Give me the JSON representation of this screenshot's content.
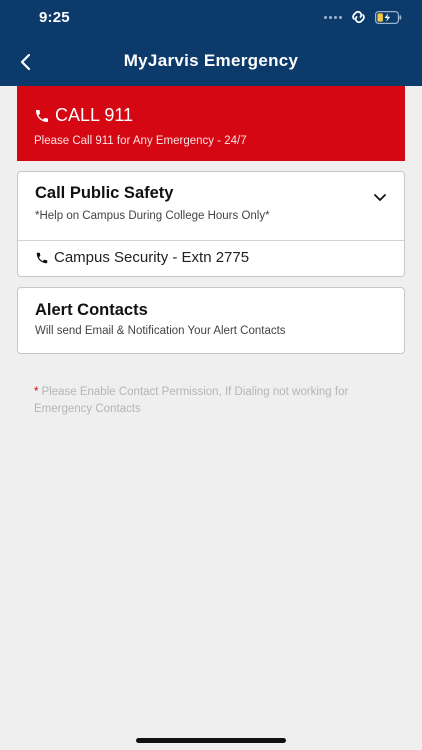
{
  "status_bar": {
    "time": "9:25"
  },
  "header": {
    "title": "MyJarvis Emergency"
  },
  "call_911": {
    "title": "CALL 911",
    "subtitle": "Please Call 911 for Any Emergency - 24/7"
  },
  "public_safety": {
    "title": "Call Public Safety",
    "subtitle": "*Help on Campus During College Hours Only*",
    "contact": "Campus Security - Extn 2775"
  },
  "alert_contacts": {
    "title": "Alert Contacts",
    "subtitle": "Will send Email & Notification Your Alert Contacts"
  },
  "note": {
    "asterisk": "*",
    "text": "Please Enable Contact Permission, If Dialing not working for Emergency Contacts"
  },
  "colors": {
    "header": "#0b3a6b",
    "emergency_red": "#d40712",
    "background": "#efefef"
  },
  "icons": {
    "back": "chevron-left-icon",
    "phone": "phone-icon",
    "expand": "chevron-down-icon",
    "link": "link-icon",
    "battery": "battery-charging-icon"
  }
}
